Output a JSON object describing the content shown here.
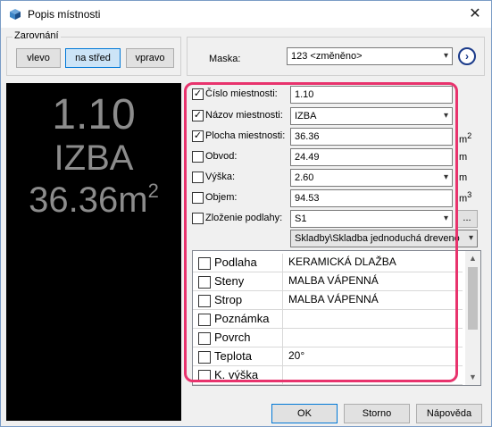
{
  "window": {
    "title": "Popis místnosti",
    "close_glyph": "✕"
  },
  "alignment": {
    "legend": "Zarovnání",
    "left": "vlevo",
    "center": "na střed",
    "right": "vpravo"
  },
  "mask": {
    "label": "Maska:",
    "value": "123 <změněno>",
    "go_glyph": "›"
  },
  "preview": {
    "number": "1.10",
    "name": "IZBA",
    "area": "36.36m",
    "area_sup": "2"
  },
  "fields": {
    "number": {
      "label": "Číslo miestnosti:",
      "value": "1.10",
      "checked": true
    },
    "name": {
      "label": "Názov miestnosti:",
      "value": "IZBA",
      "checked": true
    },
    "area": {
      "label": "Plocha miestnosti:",
      "value": "36.36",
      "checked": true,
      "unit": "m",
      "unit_sup": "2"
    },
    "perimeter": {
      "label": "Obvod:",
      "value": "24.49",
      "checked": false,
      "unit": "m"
    },
    "height": {
      "label": "Výška:",
      "value": "2.60",
      "checked": false,
      "unit": "m"
    },
    "volume": {
      "label": "Objem:",
      "value": "94.53",
      "checked": false,
      "unit": "m",
      "unit_sup": "3"
    },
    "floor": {
      "label": "Zloženie podlahy:",
      "value": "S1",
      "checked": false,
      "browse": "..."
    },
    "floor_path": {
      "value": "Skladby\\Skladba jednoduchá dreveno"
    }
  },
  "properties": [
    {
      "name": "Podlaha",
      "value": "KERAMICKÁ DLAŽBA"
    },
    {
      "name": "Steny",
      "value": "MALBA VÁPENNÁ"
    },
    {
      "name": "Strop",
      "value": "MALBA VÁPENNÁ"
    },
    {
      "name": "Poznámka",
      "value": ""
    },
    {
      "name": "Povrch",
      "value": ""
    },
    {
      "name": "Teplota",
      "value": "20°"
    },
    {
      "name": "K. výška",
      "value": ""
    }
  ],
  "buttons": {
    "ok": "OK",
    "cancel": "Storno",
    "help": "Nápověda"
  },
  "colors": {
    "highlight": "#e8336d",
    "preview_bg": "#000000",
    "preview_text": "#8c8c8c"
  }
}
